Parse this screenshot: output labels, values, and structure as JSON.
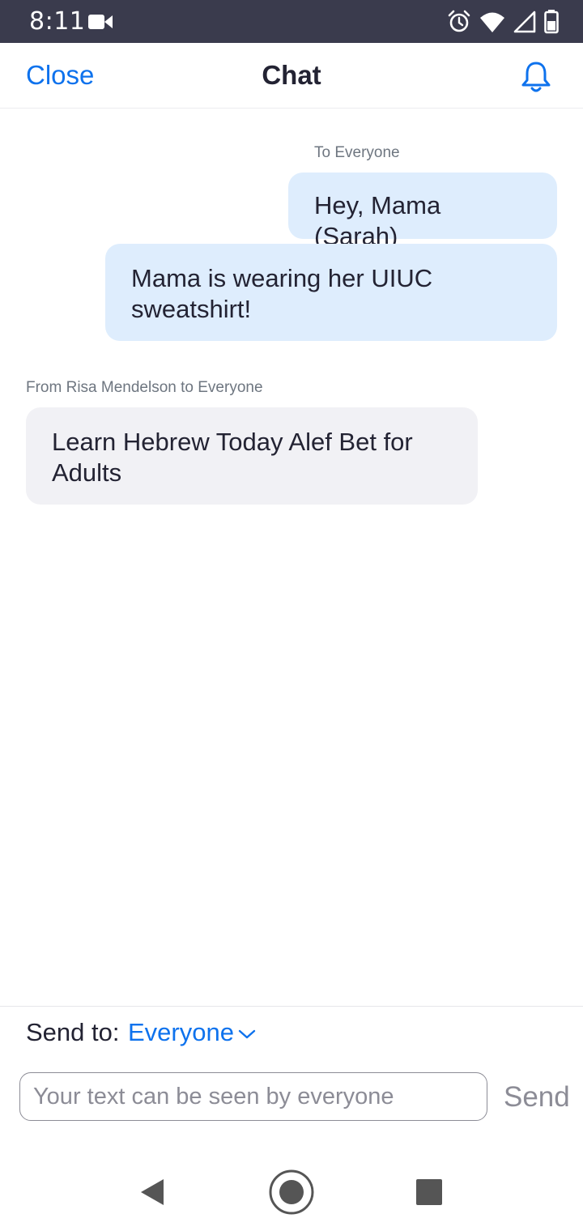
{
  "status_bar": {
    "time": "8:11",
    "icons": [
      "video-camera-icon",
      "alarm-icon",
      "wifi-icon",
      "cell-signal-icon",
      "battery-icon"
    ]
  },
  "header": {
    "close_label": "Close",
    "title": "Chat",
    "bell_icon": "bell-icon"
  },
  "messages": [
    {
      "meta": "To Everyone",
      "bubbles": [
        "Hey, Mama (Sarah)",
        "Mama is wearing her UIUC sweatshirt!"
      ],
      "direction": "outgoing"
    },
    {
      "meta": "From Risa Mendelson to Everyone",
      "bubbles": [
        "Learn Hebrew Today Alef Bet for Adults"
      ],
      "direction": "incoming"
    }
  ],
  "compose": {
    "send_to_label": "Send to:",
    "send_to_value": "Everyone",
    "input_placeholder": "Your text can be seen by everyone",
    "input_value": "",
    "send_label": "Send"
  },
  "colors": {
    "accent": "#0e72ed",
    "status_bar": "#3a3b4d",
    "outgoing_bubble": "#deedfd",
    "incoming_bubble": "#f1f1f5"
  }
}
